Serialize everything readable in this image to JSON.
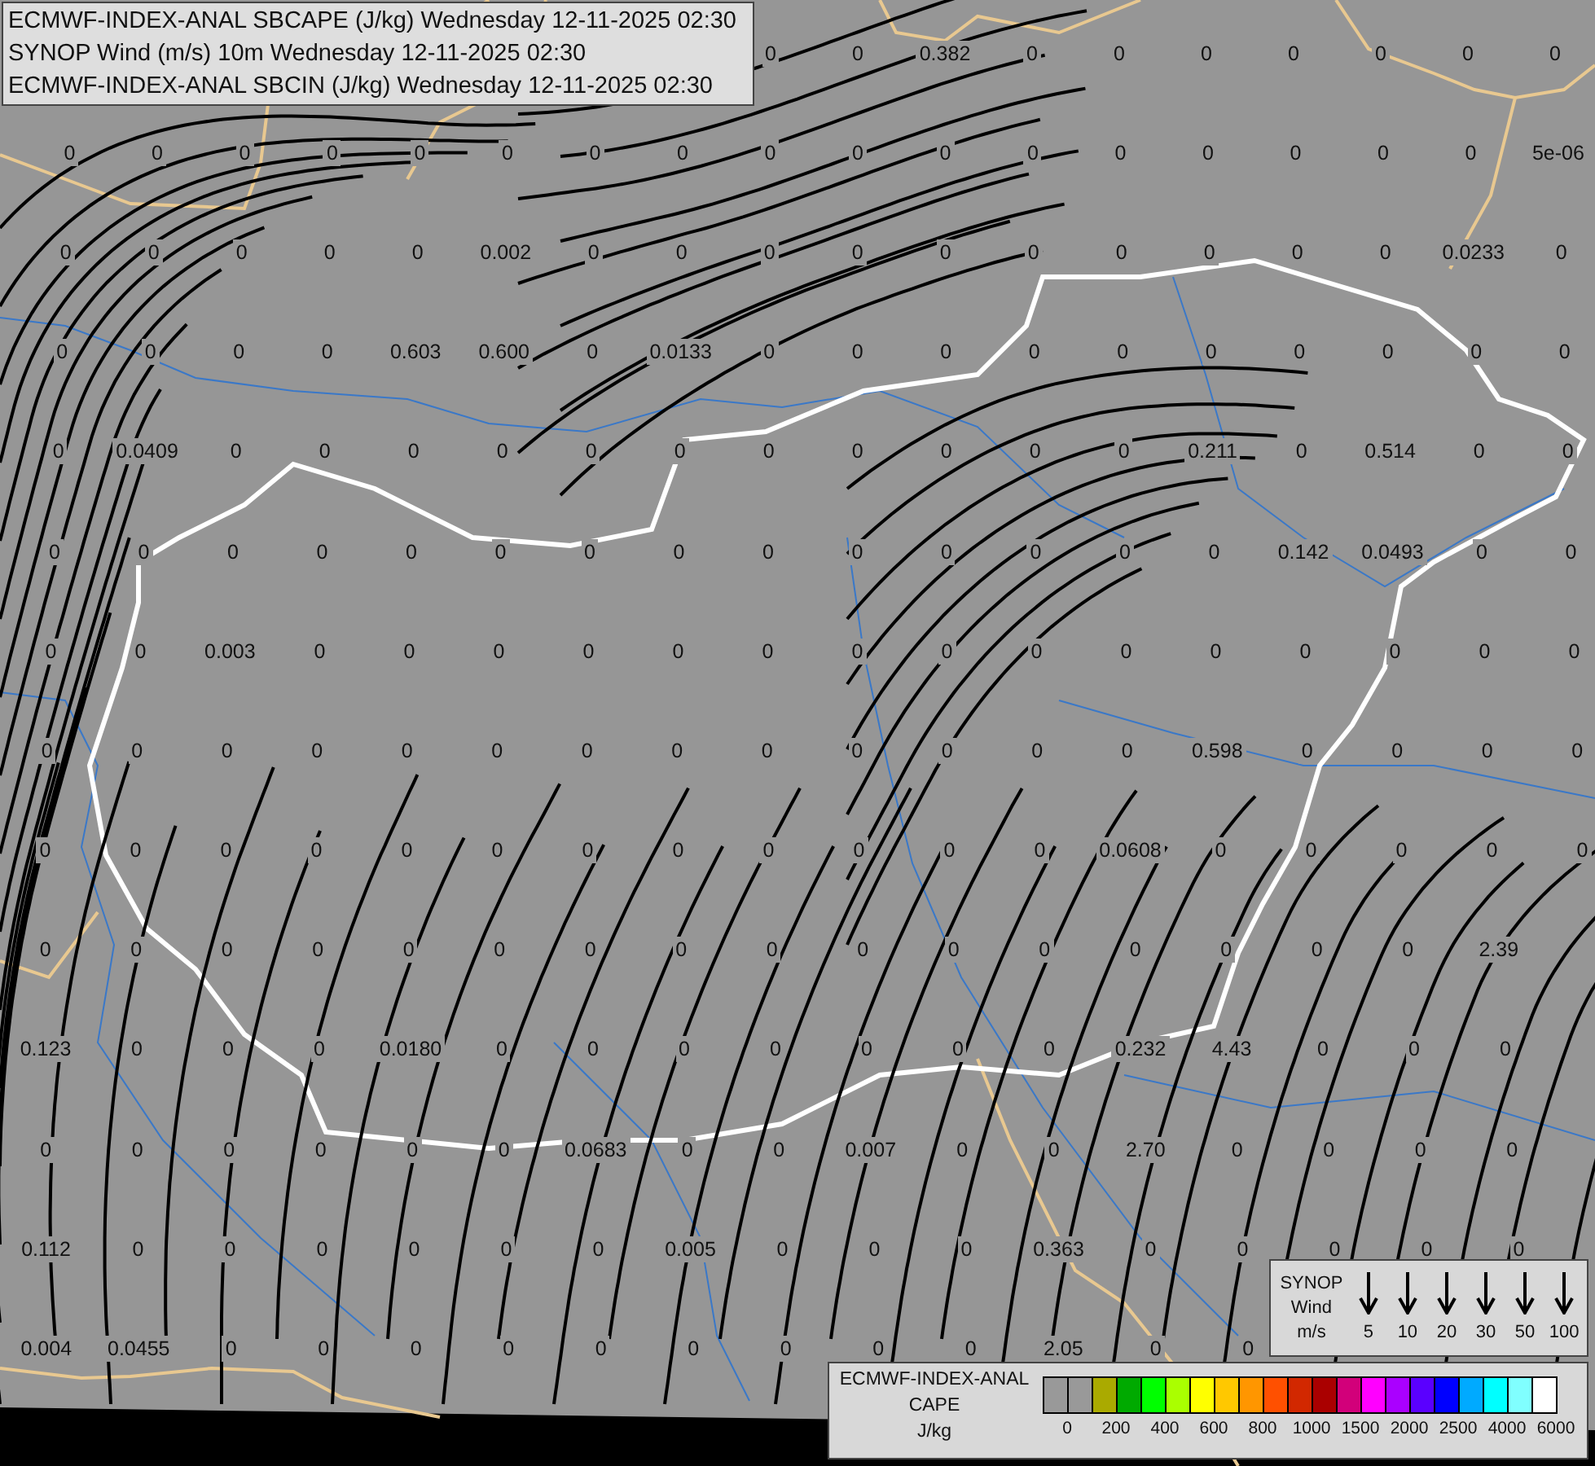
{
  "title_lines": [
    "ECMWF-INDEX-ANAL SBCAPE (J/kg) Wednesday 12-11-2025 02:30",
    "SYNOP Wind (m/s) 10m Wednesday 12-11-2025 02:30",
    "ECMWF-INDEX-ANAL SBCIN (J/kg) Wednesday 12-11-2025 02:30"
  ],
  "grid_top_row_beside_title": [
    "0",
    "0",
    "0.382",
    "0",
    "0",
    "0",
    "0",
    "0",
    "0",
    "0"
  ],
  "grid_labels": [
    [
      "0",
      "0",
      "0",
      "0",
      "0",
      "0",
      "0",
      "0",
      "0",
      "0",
      "0",
      "0",
      "0",
      "0",
      "0",
      "0",
      "0",
      "5e-06"
    ],
    [
      "0",
      "0",
      "0",
      "0",
      "0",
      "0.002",
      "0",
      "0",
      "0",
      "0",
      "0",
      "0",
      "0",
      "0",
      "0",
      "0",
      "0.0233",
      "0"
    ],
    [
      "0",
      "0",
      "0",
      "0",
      "0.603",
      "0.600",
      "0",
      "0.0133",
      "0",
      "0",
      "0",
      "0",
      "0",
      "0",
      "0",
      "0",
      "0",
      "0"
    ],
    [
      "0",
      "0.0409",
      "0",
      "0",
      "0",
      "0",
      "0",
      "0",
      "0",
      "0",
      "0",
      "0",
      "0",
      "0.211",
      "0",
      "0.514",
      "0",
      "0"
    ],
    [
      "0",
      "0",
      "0",
      "0",
      "0",
      "0",
      "0",
      "0",
      "0",
      "0",
      "0",
      "0",
      "0",
      "0",
      "0.142",
      "0.0493",
      "0",
      "0"
    ],
    [
      "0",
      "0",
      "0.003",
      "0",
      "0",
      "0",
      "0",
      "0",
      "0",
      "0",
      "0",
      "0",
      "0",
      "0",
      "0",
      "0",
      "0",
      "0"
    ],
    [
      "0",
      "0",
      "0",
      "0",
      "0",
      "0",
      "0",
      "0",
      "0",
      "0",
      "0",
      "0",
      "0",
      "0.598",
      "0",
      "0",
      "0",
      "0"
    ],
    [
      "0",
      "0",
      "0",
      "0",
      "0",
      "0",
      "0",
      "0",
      "0",
      "0",
      "0",
      "0",
      "0.0608",
      "0",
      "0",
      "0",
      "0",
      "0"
    ],
    [
      "0",
      "0",
      "0",
      "0",
      "0",
      "0",
      "0",
      "0",
      "0",
      "0",
      "0",
      "0",
      "0",
      "0",
      "0",
      "0",
      "2.39"
    ],
    [
      "0.123",
      "0",
      "0",
      "0",
      "0.0180",
      "0",
      "0",
      "0",
      "0",
      "0",
      "0",
      "0",
      "0.232",
      "4.43",
      "0",
      "0",
      "0"
    ],
    [
      "0",
      "0",
      "0",
      "0",
      "0",
      "0",
      "0.0683",
      "0",
      "0",
      "0.007",
      "0",
      "0",
      "2.70",
      "0",
      "0",
      "0",
      "0"
    ],
    [
      "0.112",
      "0",
      "0",
      "0",
      "0",
      "0",
      "0",
      "0.005",
      "0",
      "0",
      "0",
      "0.363",
      "0",
      "0",
      "0",
      "0",
      "0"
    ],
    [
      "0.004",
      "0.0455",
      "0",
      "0",
      "0",
      "0",
      "0",
      "0",
      "0",
      "0",
      "0",
      "2.05",
      "0",
      "0"
    ]
  ],
  "synop_legend": {
    "title_lines": [
      "SYNOP",
      "Wind",
      "m/s"
    ],
    "speeds": [
      "5",
      "10",
      "20",
      "30",
      "50",
      "100"
    ]
  },
  "cape_legend": {
    "title_lines": [
      "ECMWF-INDEX-ANAL",
      "CAPE"
    ],
    "unit": "J/kg",
    "swatches": [
      {
        "color": "#999999"
      },
      {
        "color": "#999999"
      },
      {
        "color": "#aaaa00"
      },
      {
        "color": "#00aa00"
      },
      {
        "color": "#00ff00"
      },
      {
        "color": "#aaff00"
      },
      {
        "color": "#ffff00"
      },
      {
        "color": "#ffc800"
      },
      {
        "color": "#ff9600"
      },
      {
        "color": "#ff5000"
      },
      {
        "color": "#d22800"
      },
      {
        "color": "#aa0000"
      },
      {
        "color": "#d2007a"
      },
      {
        "color": "#ff00ff"
      },
      {
        "color": "#aa00ff"
      },
      {
        "color": "#5a00ff"
      },
      {
        "color": "#0000ff"
      },
      {
        "color": "#00aaff"
      },
      {
        "color": "#00ffff"
      },
      {
        "color": "#80ffff"
      },
      {
        "color": "#ffffff"
      }
    ],
    "tick_labels": [
      "0",
      "200",
      "400",
      "600",
      "800",
      "1000",
      "1500",
      "2000",
      "2500",
      "4000",
      "6000"
    ]
  }
}
